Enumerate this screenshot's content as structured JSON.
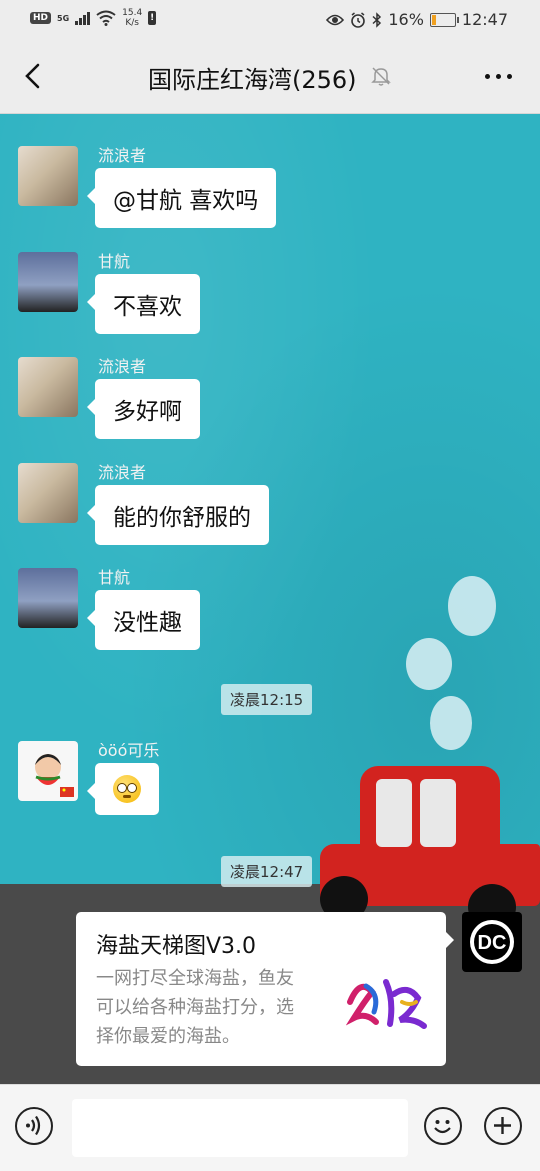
{
  "status_bar": {
    "hd": "HD",
    "network": "5G",
    "speed_value": "15.4",
    "speed_unit": "K/s",
    "battery_percent": "16%",
    "time": "12:47",
    "battery_level": 0.16,
    "battery_color": "#f0a020"
  },
  "header": {
    "title": "国际庄红海湾(256)"
  },
  "messages": [
    {
      "sender": "流浪者",
      "text": "@甘航  喜欢吗",
      "avatar": "cat-group-avatar"
    },
    {
      "sender": "甘航",
      "text": "不喜欢",
      "avatar": "sky-landscape-avatar"
    },
    {
      "sender": "流浪者",
      "text": "多好啊",
      "avatar": "cat-group-avatar"
    },
    {
      "sender": "流浪者",
      "text": "能的你舒服的",
      "avatar": "cat-group-avatar"
    },
    {
      "sender": "甘航",
      "text": "没性趣",
      "avatar": "sky-landscape-avatar"
    },
    {
      "sender": "òöó可乐",
      "text": "",
      "emoji": "flushed-face-emoji",
      "avatar": "child-watermelon-avatar"
    }
  ],
  "timestamps": [
    "凌晨12:15",
    "凌晨12:47"
  ],
  "shared_card": {
    "title": "海盐天梯图V3.0",
    "desc_lines": [
      "一网打尽全球海盐，鱼友",
      "可以给各种海盐打分，选",
      "择你最爱的海盐。"
    ],
    "sender_avatar": "DC"
  },
  "colors": {
    "wallpaper": "#2fb3c2",
    "bubble": "#ffffff",
    "car": "#d2231f"
  }
}
